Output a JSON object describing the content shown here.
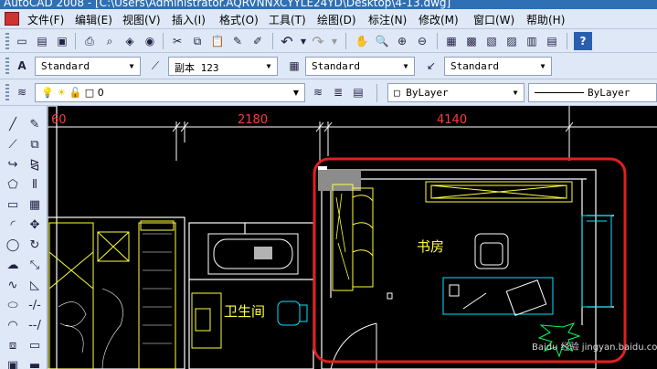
{
  "window": {
    "title": "AutoCAD 2008 - [C:\\Users\\Administrator.AQRVNNXCYYLE24YD\\Desktop\\4-13.dwg]"
  },
  "menu": [
    "文件(F)",
    "编辑(E)",
    "视图(V)",
    "插入(I)",
    "格式(O)",
    "工具(T)",
    "绘图(D)",
    "标注(N)",
    "修改(M)",
    "窗口(W)",
    "帮助(H)"
  ],
  "styles_toolbar": {
    "text_style": "Standard",
    "dim_style": "副本 123",
    "table_style": "Standard",
    "multileader_style": "Standard"
  },
  "layers_toolbar": {
    "layer": "0",
    "color": "ByLayer",
    "linetype": "ByLayer"
  },
  "drawing": {
    "dimensions": [
      "60",
      "2180",
      "4140"
    ],
    "rooms": {
      "study": "书房",
      "bathroom": "卫生间"
    },
    "watermark": "Baidu 经验 jingyan.baidu.com"
  },
  "colors": {
    "ui_background": "#dfe8f6",
    "canvas": "#000000",
    "dimension": "#ff3b3b",
    "wall": "#ffffff",
    "furniture": "#ffff3c",
    "fixture": "#00e5ff",
    "highlight": "#e02020"
  }
}
